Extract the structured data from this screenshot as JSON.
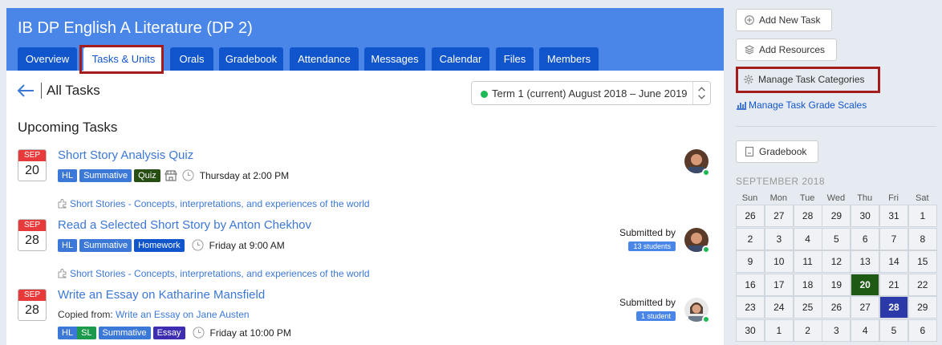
{
  "course": {
    "title": "IB DP English A Literature (DP 2)"
  },
  "tabs": [
    {
      "label": "Overview"
    },
    {
      "label": "Tasks & Units",
      "active": true
    },
    {
      "label": "Orals"
    },
    {
      "label": "Gradebook"
    },
    {
      "label": "Attendance"
    },
    {
      "label": "Messages"
    },
    {
      "label": "Calendar"
    },
    {
      "label": "Files"
    },
    {
      "label": "Members"
    }
  ],
  "page": {
    "title": "All Tasks",
    "section_title": "Upcoming Tasks"
  },
  "term_select": {
    "value": "Term 1 (current) August 2018 – June 2019"
  },
  "tasks": [
    {
      "month": "SEP",
      "day": "20",
      "title": "Short Story Analysis Quiz",
      "badges": [
        "HL",
        "Summative",
        "Quiz"
      ],
      "time": "Thursday at 2:00 PM",
      "unit": "Short Stories - Concepts, interpretations, and experiences of the world"
    },
    {
      "month": "SEP",
      "day": "28",
      "title": "Read a Selected Short Story by Anton Chekhov",
      "badges": [
        "HL",
        "Summative",
        "Homework"
      ],
      "time": "Friday at 9:00 AM",
      "unit": "Short Stories - Concepts, interpretations, and experiences of the world",
      "submitted_label": "Submitted by",
      "submitted_count": "13 students"
    },
    {
      "month": "SEP",
      "day": "28",
      "title": "Write an Essay on Katharine Mansfield",
      "copied_label": "Copied from:",
      "copied_link": "Write an Essay on Jane Austen",
      "badges": [
        "HL",
        "SL",
        "Summative",
        "Essay"
      ],
      "time": "Friday at 10:00 PM",
      "submitted_label": "Submitted by",
      "submitted_count": "1 student"
    }
  ],
  "sidebar": {
    "add_new_task": "Add New Task",
    "add_resources": "Add Resources",
    "manage_categories": "Manage Task Categories",
    "manage_grade_scales": "Manage Task Grade Scales",
    "gradebook": "Gradebook"
  },
  "calendar": {
    "title": "SEPTEMBER 2018",
    "days_of_week": [
      "Sun",
      "Mon",
      "Tue",
      "Wed",
      "Thu",
      "Fri",
      "Sat"
    ],
    "weeks": [
      [
        "26",
        "27",
        "28",
        "29",
        "30",
        "31",
        "1"
      ],
      [
        "2",
        "3",
        "4",
        "5",
        "6",
        "7",
        "8"
      ],
      [
        "9",
        "10",
        "11",
        "12",
        "13",
        "14",
        "15"
      ],
      [
        "16",
        "17",
        "18",
        "19",
        "20",
        "21",
        "22"
      ],
      [
        "23",
        "24",
        "25",
        "26",
        "27",
        "28",
        "29"
      ],
      [
        "30",
        "1",
        "2",
        "3",
        "4",
        "5",
        "6"
      ]
    ],
    "today": "20",
    "selected": "28"
  },
  "colors": {
    "header": "#4a86e8",
    "tab": "#1155cc",
    "highlight_box": "#a61c1c",
    "date_month": "#e83a3a",
    "today": "#1e5a14",
    "selected": "#2b3aa8"
  }
}
